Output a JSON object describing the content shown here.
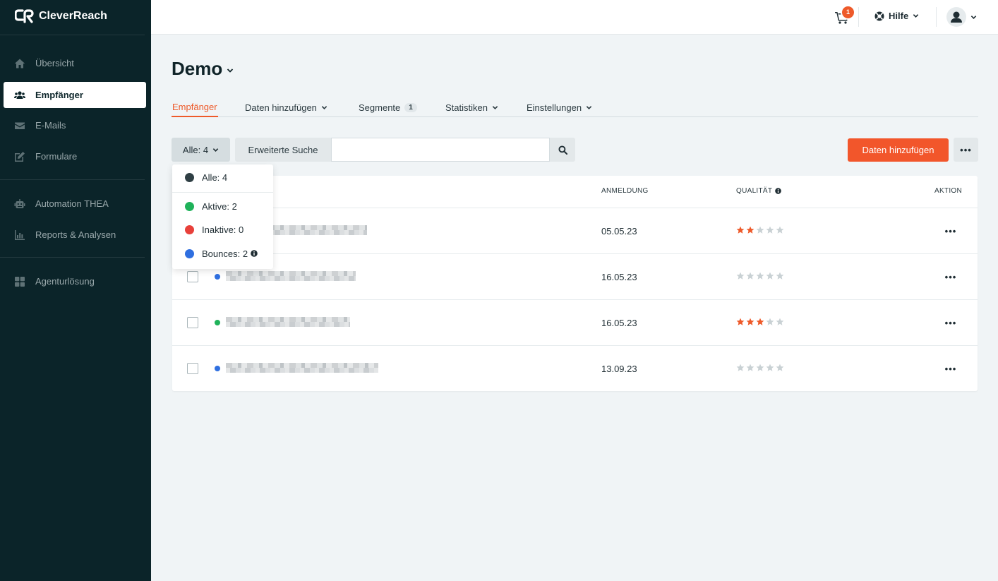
{
  "app": {
    "brand": "CleverReach"
  },
  "sidebar": {
    "items": [
      {
        "label": "Übersicht",
        "icon": "home-icon"
      },
      {
        "label": "Empfänger",
        "icon": "users-icon",
        "active": true
      },
      {
        "label": "E-Mails",
        "icon": "envelope-icon"
      },
      {
        "label": "Formulare",
        "icon": "edit-icon"
      },
      {
        "label": "Automation THEA",
        "icon": "robot-icon"
      },
      {
        "label": "Reports & Analysen",
        "icon": "bar-chart-icon"
      },
      {
        "label": "Agenturlösung",
        "icon": "grid-icon"
      }
    ]
  },
  "topbar": {
    "cart_count": "1",
    "help_label": "Hilfe"
  },
  "page": {
    "title": "Demo"
  },
  "tabs": [
    {
      "label": "Empfänger",
      "active": true
    },
    {
      "label": "Daten hinzufügen"
    },
    {
      "label": "Segmente",
      "count": "1"
    },
    {
      "label": "Statistiken"
    },
    {
      "label": "Einstellungen"
    }
  ],
  "toolbar": {
    "filter_label": "Alle: 4",
    "advanced_search_label": "Erweiterte Suche",
    "search_value": "",
    "search_placeholder": "",
    "primary_label": "Daten hinzufügen",
    "more_label": "•••"
  },
  "filter_dropdown": {
    "items": [
      {
        "label": "Alle: 4",
        "color": "#2f3f44"
      },
      {
        "label": "Aktive: 2",
        "color": "#1fb25a"
      },
      {
        "label": "Inaktive: 0",
        "color": "#e8403a"
      },
      {
        "label": "Bounces: 2",
        "color": "#2f6fe0",
        "info": true
      }
    ]
  },
  "table": {
    "headers": {
      "registration": "ANMELDUNG",
      "quality": "QUALITÄT",
      "action": "AKTION"
    },
    "rows": [
      {
        "status_color": "#2f6fe0",
        "date": "05.05.23",
        "rating": 2,
        "action": "•••"
      },
      {
        "status_color": "#2f6fe0",
        "date": "16.05.23",
        "rating": 0,
        "action": "•••"
      },
      {
        "status_color": "#1fb25a",
        "date": "16.05.23",
        "rating": 3,
        "action": "•••"
      },
      {
        "status_color": "#2f6fe0",
        "date": "13.09.23",
        "rating": 0,
        "action": "•••"
      }
    ]
  },
  "colors": {
    "sidebar_bg": "#0b2429",
    "accent": "#f2562b",
    "star_on": "#ee5a2a",
    "star_off": "#c9d1d4"
  }
}
